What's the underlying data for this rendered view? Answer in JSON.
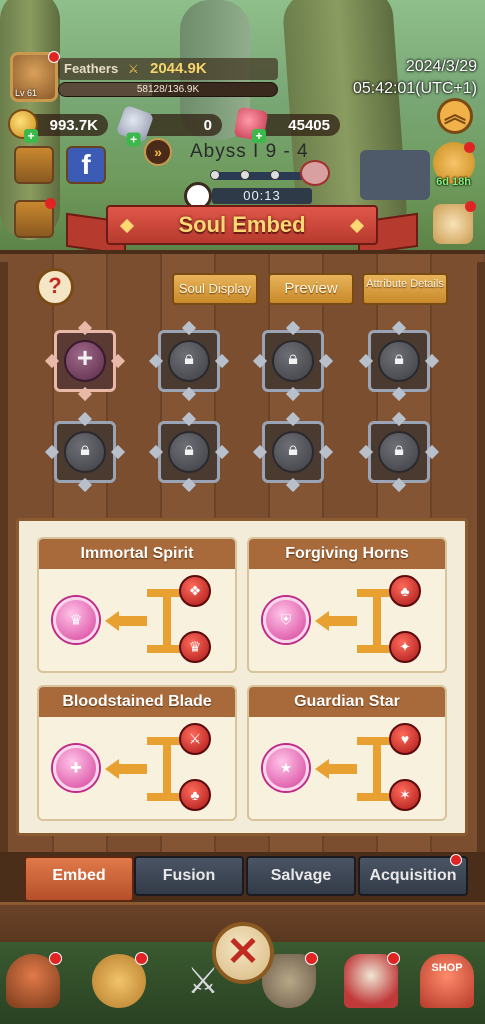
{
  "player": {
    "name": "Feathers",
    "level": "Lv 61",
    "power": "2044.9K",
    "xp_text": "58128/136.9K",
    "xp_fraction": 0.425
  },
  "datetime": {
    "date": "2024/3/29",
    "time": "05:42:01(UTC+1)"
  },
  "currencies": [
    {
      "name": "gold",
      "value": "993.7K"
    },
    {
      "name": "gem",
      "value": "0"
    },
    {
      "name": "ruby",
      "value": "45405"
    }
  ],
  "stage": {
    "label": "Abyss I 9 - 4",
    "timer": "00:13"
  },
  "event": {
    "timer": "6d 18h"
  },
  "title": "Soul Embed",
  "buttons": {
    "help": "?",
    "soul_display": "Soul Display",
    "preview": "Preview",
    "attribute_details": "Attribute Details",
    "close": "✕",
    "add_slot": "+"
  },
  "slots": [
    {
      "state": "open"
    },
    {
      "state": "locked"
    },
    {
      "state": "locked"
    },
    {
      "state": "locked"
    },
    {
      "state": "locked"
    },
    {
      "state": "locked"
    },
    {
      "state": "locked"
    },
    {
      "state": "locked"
    }
  ],
  "recipes": [
    {
      "name": "Immortal Spirit",
      "result_icon": "spirit-icon",
      "ingredient_icons": [
        "soul-red-icon",
        "crown-red-icon"
      ]
    },
    {
      "name": "Forgiving Horns",
      "result_icon": "horns-shield-icon",
      "ingredient_icons": [
        "mushroom-red-icon",
        "feather-red-icon"
      ]
    },
    {
      "name": "Bloodstained Blade",
      "result_icon": "blade-mushroom-icon",
      "ingredient_icons": [
        "sword-red-icon",
        "mushroom-red-icon"
      ]
    },
    {
      "name": "Guardian Star",
      "result_icon": "star-guardian-icon",
      "ingredient_icons": [
        "heart-red-icon",
        "star-red-icon"
      ]
    }
  ],
  "tabs": [
    {
      "label": "Embed",
      "active": true
    },
    {
      "label": "Fusion",
      "active": false
    },
    {
      "label": "Salvage",
      "active": false
    },
    {
      "label": "Acquisition",
      "active": false,
      "badge": true
    }
  ],
  "nav": {
    "shop_label": "SHOP"
  },
  "colors": {
    "accent_gold": "#ffd874",
    "ribbon_red": "#b73a2e",
    "wood": "#7a4e2e",
    "tab_active": "#e07a4a",
    "soul_pink": "#d6409a",
    "ingredient_red": "#a81818"
  }
}
